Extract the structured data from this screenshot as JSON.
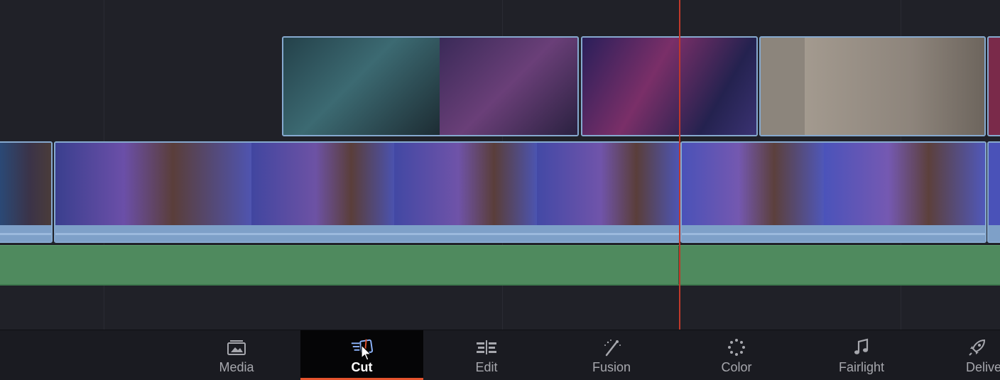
{
  "timeline": {
    "playhead_color": "#c0392b",
    "clip_border_color": "#86a9cf",
    "audio_color": "#4f8a5e"
  },
  "pages": [
    {
      "label": "Media",
      "icon": "media-icon"
    },
    {
      "label": "Cut",
      "icon": "cut-icon",
      "active": true
    },
    {
      "label": "Edit",
      "icon": "edit-icon"
    },
    {
      "label": "Fusion",
      "icon": "fusion-icon"
    },
    {
      "label": "Color",
      "icon": "color-icon"
    },
    {
      "label": "Fairlight",
      "icon": "fairlight-icon"
    },
    {
      "label": "Delive",
      "icon": "deliver-icon"
    }
  ],
  "colors": {
    "accent_active": "#e4532d",
    "page_label": "#a6a7ad"
  }
}
